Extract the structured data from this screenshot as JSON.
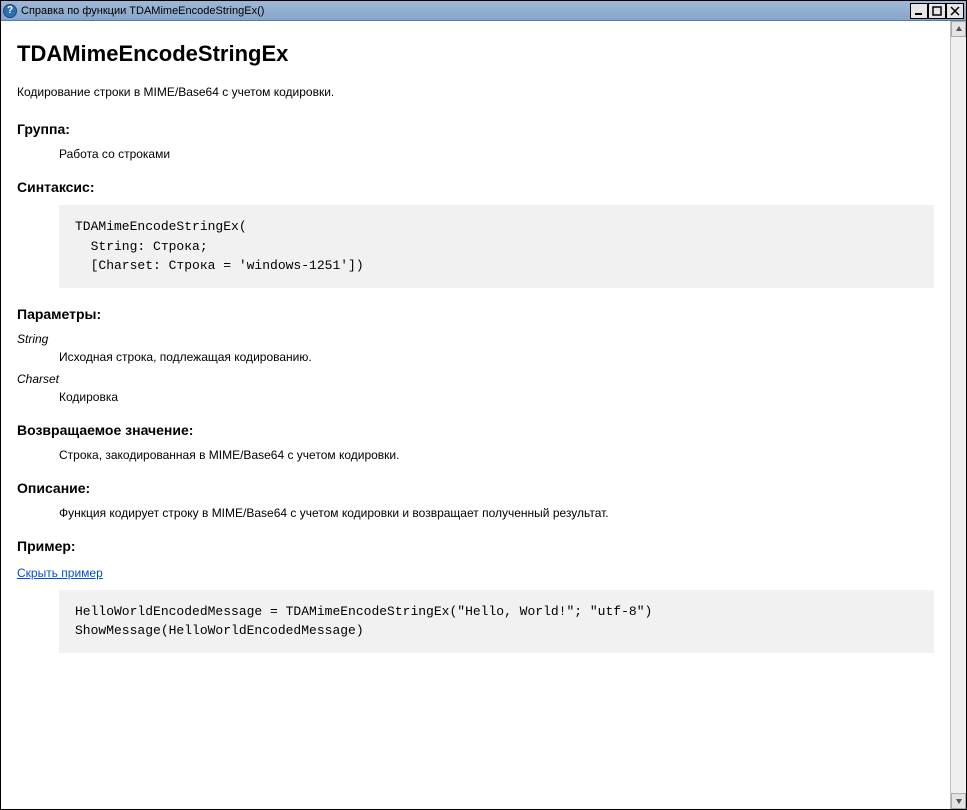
{
  "window": {
    "title": "Справка по функции TDAMimeEncodeStringEx()"
  },
  "page": {
    "title": "TDAMimeEncodeStringEx",
    "intro": "Кодирование строки в MIME/Base64 с учетом кодировки."
  },
  "sections": {
    "group_heading": "Группа:",
    "group_value": "Работа со строками",
    "syntax_heading": "Синтаксис:",
    "syntax_code": "TDAMimeEncodeStringEx(\n  String: Строка;\n  [Charset: Строка = 'windows-1251'])",
    "params_heading": "Параметры:",
    "params": [
      {
        "name": "String",
        "desc": "Исходная строка, подлежащая кодированию."
      },
      {
        "name": "Charset",
        "desc": "Кодировка"
      }
    ],
    "return_heading": "Возвращаемое значение:",
    "return_value": "Строка, закодированная в MIME/Base64 с учетом кодировки.",
    "desc_heading": "Описание:",
    "desc_value": "Функция кодирует строку в MIME/Base64 с учетом кодировки и возвращает полученный результат.",
    "example_heading": "Пример:",
    "example_toggle": "Скрыть пример",
    "example_code": "HelloWorldEncodedMessage = TDAMimeEncodeStringEx(\"Hello, World!\"; \"utf-8\")\nShowMessage(HelloWorldEncodedMessage)"
  }
}
